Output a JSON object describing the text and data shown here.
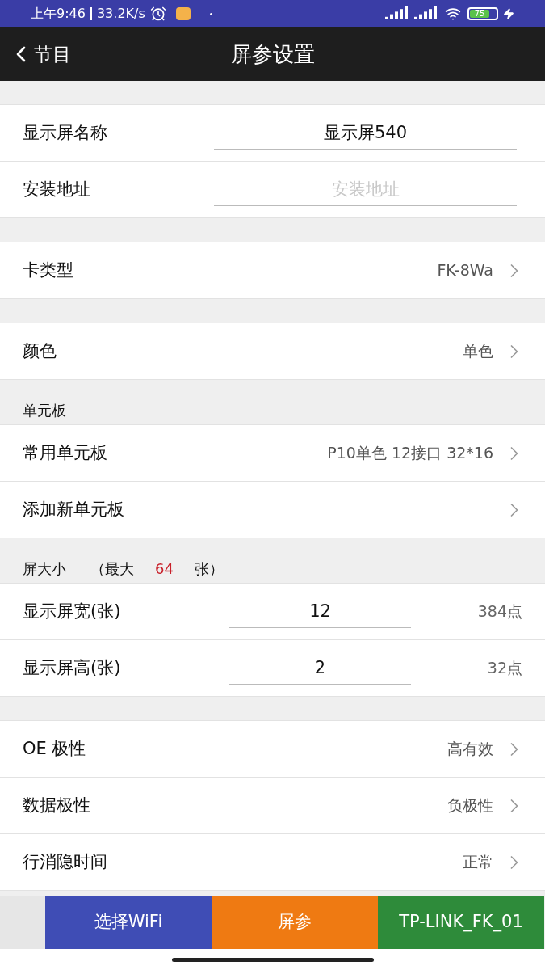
{
  "status_bar": {
    "time": "上午9:46",
    "speed": "33.2K/s",
    "battery": "75"
  },
  "nav": {
    "back": "节目",
    "title": "屏参设置"
  },
  "sections": [
    {
      "items": [
        {
          "kind": "input",
          "label": "显示屏名称",
          "value": "显示屏540"
        },
        {
          "kind": "input",
          "label": "安装地址",
          "placeholder": "安装地址"
        }
      ]
    },
    {
      "items": [
        {
          "kind": "select",
          "label": "卡类型",
          "value": "FK-8Wa"
        }
      ]
    },
    {
      "items": [
        {
          "kind": "select",
          "label": "颜色",
          "value": "单色"
        }
      ]
    },
    {
      "header": [
        "单元板"
      ],
      "items": [
        {
          "kind": "select",
          "label": "常用单元板",
          "value": "P10单色 12接口 32*16"
        },
        {
          "kind": "select",
          "label": "添加新单元板"
        }
      ]
    },
    {
      "header": [
        "屏大小",
        "（最大",
        "64",
        "张）"
      ],
      "items": [
        {
          "kind": "number",
          "label": "显示屏宽(张)",
          "value": "12",
          "unit": "384点"
        },
        {
          "kind": "number",
          "label": "显示屏高(张)",
          "value": "2",
          "unit": "32点"
        }
      ]
    },
    {
      "items": [
        {
          "kind": "select",
          "label": "OE 极性",
          "value": "高有效"
        },
        {
          "kind": "select",
          "label": "数据极性",
          "value": "负极性"
        },
        {
          "kind": "select",
          "label": "行消隐时间",
          "value": "正常"
        }
      ]
    }
  ],
  "buttons": [
    {
      "label": "选择WiFi",
      "color": "#3f4db5"
    },
    {
      "label": "屏参",
      "color": "#ef7a12"
    },
    {
      "label": "TP-LINK_FK_01",
      "color": "#2e8b3a"
    }
  ]
}
